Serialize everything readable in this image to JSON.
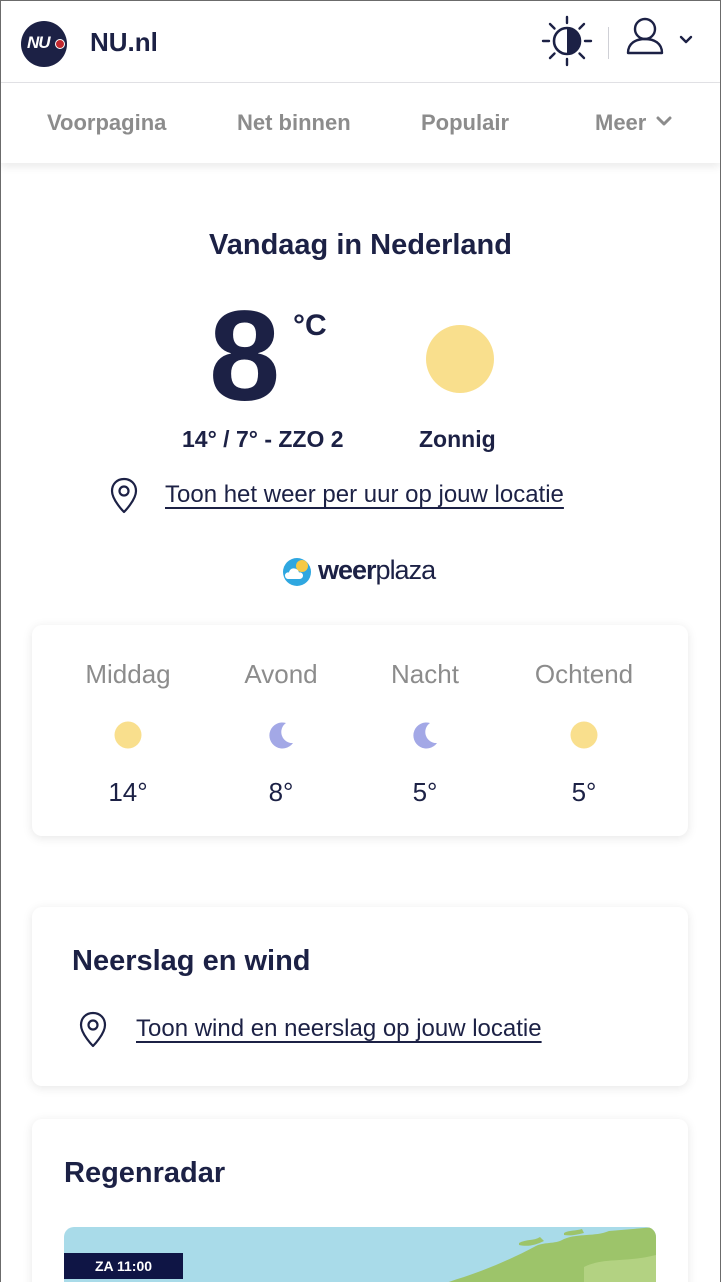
{
  "header": {
    "logo_text": "NU",
    "site_name": "NU.nl",
    "theme_toggle_icon": "contrast-sun-icon",
    "user_icon": "user-icon",
    "chevron_icon": "chevron-down-icon"
  },
  "nav": {
    "items": [
      {
        "label": "Voorpagina"
      },
      {
        "label": "Net binnen"
      },
      {
        "label": "Populair"
      },
      {
        "label": "Meer"
      }
    ]
  },
  "today": {
    "title": "Vandaag in Nederland",
    "temperature": "8",
    "unit": "°C",
    "minmax_wind": "14° / 7° - ZZO 2",
    "condition": "Zonnig",
    "location_link": "Toon het weer per uur op jouw locatie",
    "icon": "sun-icon"
  },
  "brand": {
    "name_bold": "weer",
    "name_light": "plaza"
  },
  "periods": [
    {
      "name": "Middag",
      "temp": "14°",
      "icon": "sun-icon"
    },
    {
      "name": "Avond",
      "temp": "8°",
      "icon": "moon-icon"
    },
    {
      "name": "Nacht",
      "temp": "5°",
      "icon": "moon-icon"
    },
    {
      "name": "Ochtend",
      "temp": "5°",
      "icon": "sun-icon"
    }
  ],
  "precipitation": {
    "title": "Neerslag en wind",
    "location_link": "Toon wind en neerslag op jouw locatie"
  },
  "radar": {
    "title": "Regenradar",
    "time_label": "ZA 11:00"
  },
  "colors": {
    "navy": "#1c2145",
    "sun": "#f9df8d",
    "moon": "#a3a8e6",
    "muted": "#8c8c8c",
    "sea": "#a9dbe9",
    "land": "#9dc46a"
  }
}
